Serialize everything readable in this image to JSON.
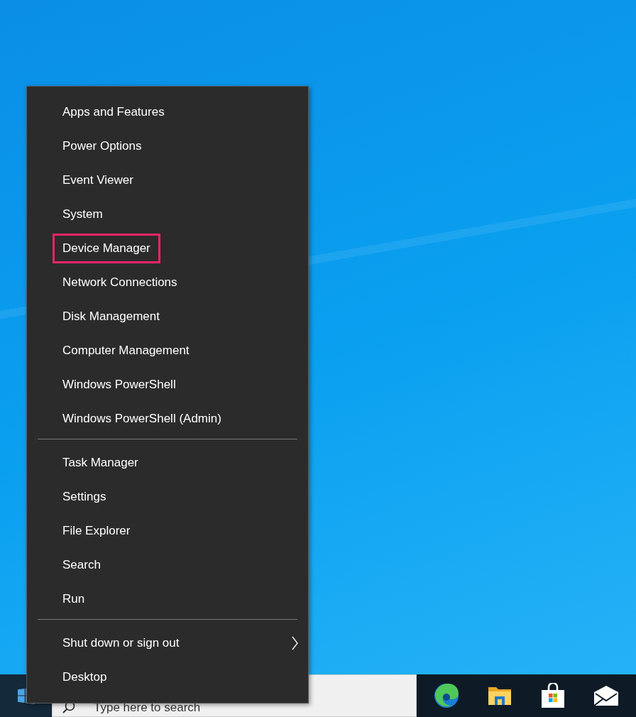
{
  "menu": {
    "groups": [
      {
        "items": [
          {
            "label": "Apps and Features",
            "highlighted": false,
            "submenu": false
          },
          {
            "label": "Power Options",
            "highlighted": false,
            "submenu": false
          },
          {
            "label": "Event Viewer",
            "highlighted": false,
            "submenu": false
          },
          {
            "label": "System",
            "highlighted": false,
            "submenu": false
          },
          {
            "label": "Device Manager",
            "highlighted": true,
            "submenu": false
          },
          {
            "label": "Network Connections",
            "highlighted": false,
            "submenu": false
          },
          {
            "label": "Disk Management",
            "highlighted": false,
            "submenu": false
          },
          {
            "label": "Computer Management",
            "highlighted": false,
            "submenu": false
          },
          {
            "label": "Windows PowerShell",
            "highlighted": false,
            "submenu": false
          },
          {
            "label": "Windows PowerShell (Admin)",
            "highlighted": false,
            "submenu": false
          }
        ]
      },
      {
        "items": [
          {
            "label": "Task Manager",
            "highlighted": false,
            "submenu": false
          },
          {
            "label": "Settings",
            "highlighted": false,
            "submenu": false
          },
          {
            "label": "File Explorer",
            "highlighted": false,
            "submenu": false
          },
          {
            "label": "Search",
            "highlighted": false,
            "submenu": false
          },
          {
            "label": "Run",
            "highlighted": false,
            "submenu": false
          }
        ]
      },
      {
        "items": [
          {
            "label": "Shut down or sign out",
            "highlighted": false,
            "submenu": true
          },
          {
            "label": "Desktop",
            "highlighted": false,
            "submenu": false
          }
        ]
      }
    ]
  },
  "taskbar": {
    "search": {
      "placeholder": "Type here to search"
    },
    "apps": [
      {
        "kind": "edge"
      },
      {
        "kind": "explorer"
      },
      {
        "kind": "store"
      },
      {
        "kind": "mail"
      }
    ]
  }
}
